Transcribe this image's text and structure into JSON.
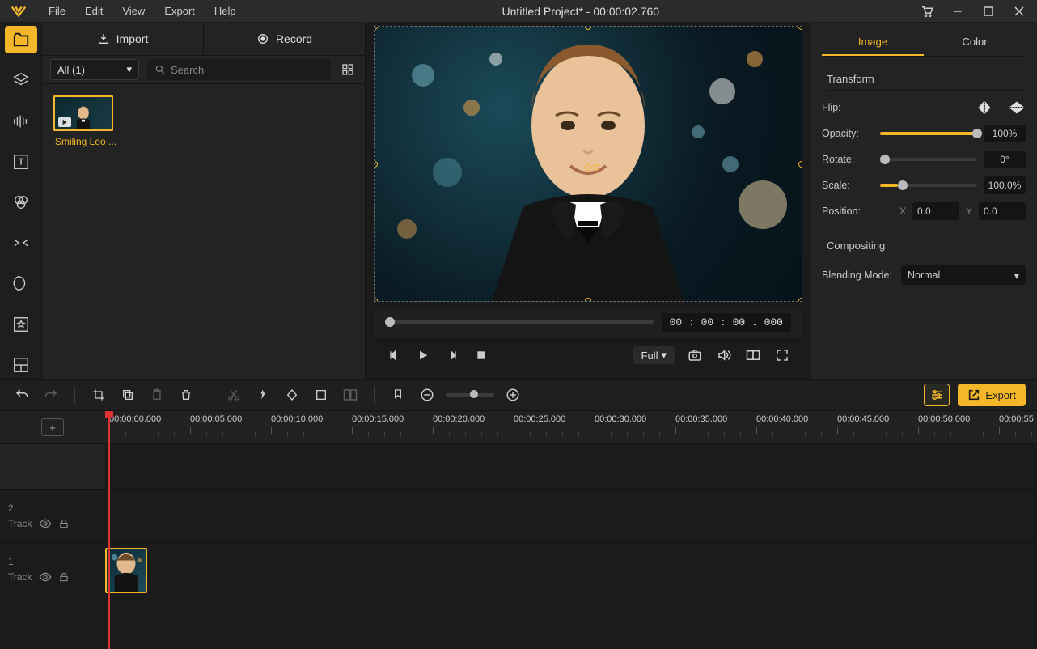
{
  "menu": {
    "file": "File",
    "edit": "Edit",
    "view": "View",
    "export": "Export",
    "help": "Help"
  },
  "title": "Untitled Project* - 00:00:02.760",
  "mediapanel": {
    "import": "Import",
    "record": "Record",
    "filter": "All (1)",
    "search_placeholder": "Search",
    "clip_label": "Smiling Leo ..."
  },
  "preview": {
    "time": "00 : 00 : 00 . 000",
    "size_label": "Full"
  },
  "props": {
    "tab_image": "Image",
    "tab_color": "Color",
    "sec_transform": "Transform",
    "sec_compositing": "Compositing",
    "flip": "Flip:",
    "opacity": "Opacity:",
    "rotate": "Rotate:",
    "scale": "Scale:",
    "position": "Position:",
    "blend": "Blending Mode:",
    "opacity_val": "100%",
    "rotate_val": "0°",
    "scale_val": "100.0%",
    "posx_lbl": "X",
    "posy_lbl": "Y",
    "posx": "0.0",
    "posy": "0.0",
    "blend_val": "Normal"
  },
  "toolbar": {
    "export": "Export"
  },
  "ruler": {
    "marks": [
      "00:00:00.000",
      "00:00:05.000",
      "00:00:10.000",
      "00:00:15.000",
      "00:00:20.000",
      "00:00:25.000",
      "00:00:30.000",
      "00:00:35.000",
      "00:00:40.000",
      "00:00:45.000",
      "00:00:50.000",
      "00:00:55"
    ]
  },
  "tracks": {
    "track2_num": "2",
    "track2_name": "Track",
    "track1_num": "1",
    "track1_name": "Track"
  }
}
